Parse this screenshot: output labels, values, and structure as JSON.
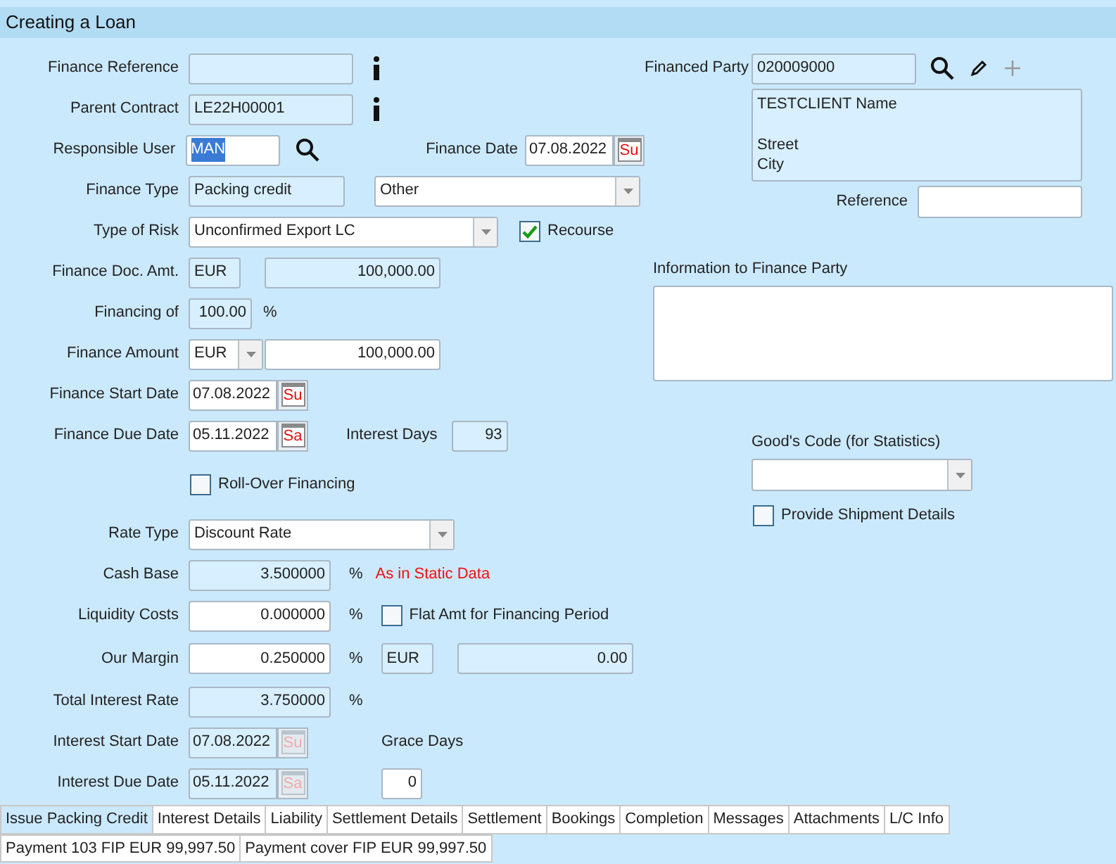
{
  "header": {
    "title": "Creating a Loan"
  },
  "form": {
    "finance_reference": {
      "label": "Finance Reference",
      "readonly": true
    },
    "parent_contract": {
      "label": "Parent Contract",
      "value": "LE22H00001",
      "readonly": true
    },
    "responsible_user": {
      "label": "Responsible User",
      "value": "MAN",
      "readonly": false,
      "text_selected": true
    },
    "finance_date": {
      "label": "Finance Date",
      "value": "07.08.2022",
      "day": "Su",
      "disabled": false
    },
    "finance_type": {
      "label": "Finance Type",
      "value": "Packing credit",
      "readonly": true
    },
    "finance_subtype": {
      "value": "Other"
    },
    "type_of_risk": {
      "label": "Type of Risk",
      "value": "Unconfirmed Export LC"
    },
    "recourse": {
      "label": "Recourse",
      "checked": true
    },
    "finance_doc_amt": {
      "label": "Finance Doc. Amt.",
      "currency": "EUR",
      "amount": "100,000.00",
      "readonly": true
    },
    "financing_of": {
      "label": "Financing of",
      "value": "100.00",
      "unit": "%",
      "readonly": true
    },
    "finance_amount": {
      "label": "Finance Amount",
      "currency": "EUR",
      "amount": "100,000.00",
      "readonly": false
    },
    "finance_start_date": {
      "label": "Finance Start Date",
      "value": "07.08.2022",
      "day": "Su",
      "disabled": false
    },
    "finance_due_date": {
      "label": "Finance Due Date",
      "value": "05.11.2022",
      "day": "Sa",
      "disabled": false
    },
    "interest_days": {
      "label": "Interest Days",
      "value": "93",
      "readonly": true
    },
    "roll_over": {
      "label": "Roll-Over Financing",
      "checked": false
    },
    "rate_type": {
      "label": "Rate Type",
      "value": "Discount Rate"
    },
    "cash_base": {
      "label": "Cash Base",
      "value": "3.500000",
      "unit": "%",
      "readonly": true,
      "note": "As in Static Data"
    },
    "liquidity_costs": {
      "label": "Liquidity Costs",
      "value": "0.000000",
      "unit": "%",
      "readonly": false
    },
    "flat_amt": {
      "label": "Flat Amt for Financing Period",
      "checked": false
    },
    "our_margin": {
      "label": "Our Margin",
      "value": "0.250000",
      "unit": "%",
      "readonly": false,
      "currency": "EUR",
      "amount": "0.00"
    },
    "total_interest_rate": {
      "label": "Total Interest Rate",
      "value": "3.750000",
      "unit": "%",
      "readonly": true
    },
    "interest_start_date": {
      "label": "Interest Start Date",
      "value": "07.08.2022",
      "day": "Su",
      "disabled": true
    },
    "grace_days": {
      "label": "Grace Days",
      "value": "0",
      "readonly": false
    },
    "interest_due_date": {
      "label": "Interest Due Date",
      "value": "05.11.2022",
      "day": "Sa",
      "disabled": true
    },
    "financed_party": {
      "label": "Financed Party",
      "value": "020009000",
      "readonly": true,
      "address": [
        "TESTCLIENT Name",
        "Street",
        "City"
      ]
    },
    "reference": {
      "label": "Reference"
    },
    "information": {
      "label": "Information to Finance Party"
    },
    "goods_code": {
      "label": "Good's Code (for Statistics)"
    },
    "shipment": {
      "label": "Provide Shipment Details",
      "checked": false
    }
  },
  "tabs": [
    {
      "label": "Issue Packing Credit",
      "selected": true
    },
    {
      "label": "Interest Details",
      "selected": false
    },
    {
      "label": "Liability",
      "selected": false
    },
    {
      "label": "Settlement Details",
      "selected": false
    },
    {
      "label": "Settlement",
      "selected": false
    },
    {
      "label": "Bookings",
      "selected": false
    },
    {
      "label": "Completion",
      "selected": false
    },
    {
      "label": "Messages",
      "selected": false
    },
    {
      "label": "Attachments",
      "selected": false
    },
    {
      "label": "L/C Info",
      "selected": false
    }
  ],
  "sub_tabs": [
    {
      "label": "Payment 103 FIP EUR 99,997.50",
      "selected": false
    },
    {
      "label": "Payment cover FIP EUR 99,997.50",
      "selected": false
    }
  ]
}
